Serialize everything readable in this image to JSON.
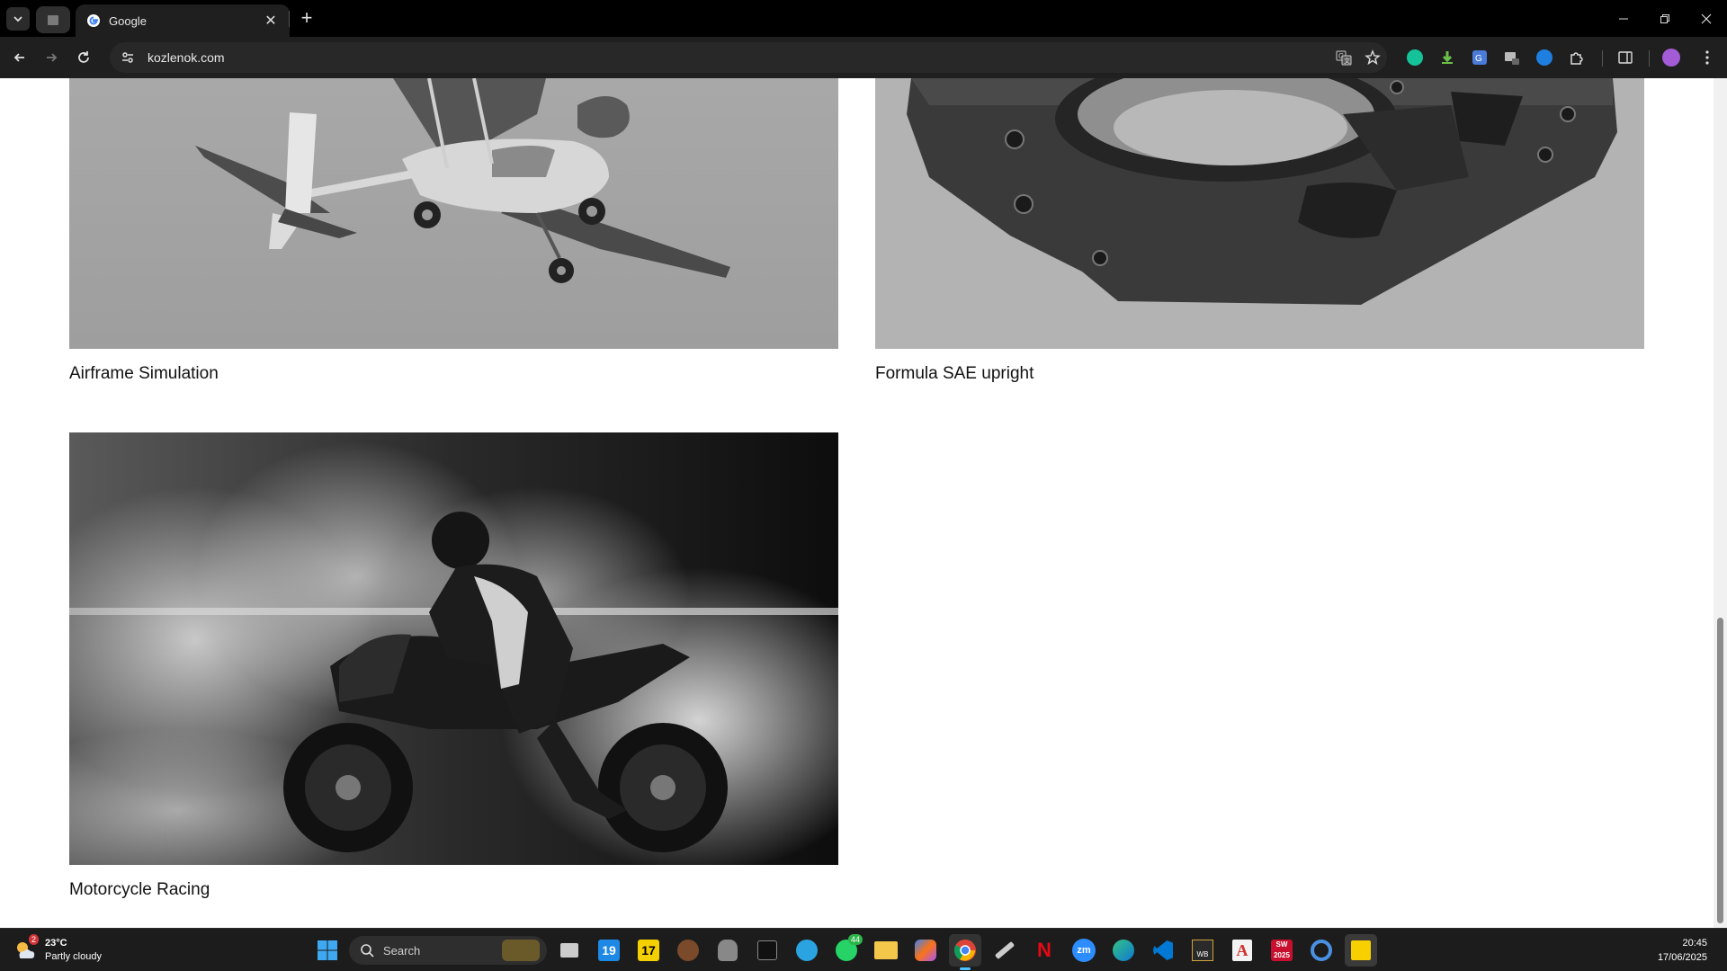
{
  "browser": {
    "tab_title": "Google",
    "url": "kozlenok.com"
  },
  "page": {
    "cards": [
      {
        "caption": "Airframe Simulation"
      },
      {
        "caption": "Formula SAE upright"
      },
      {
        "caption": "Motorcycle Racing"
      }
    ]
  },
  "taskbar": {
    "weather": {
      "temp": "23°C",
      "condition": "Partly cloudy",
      "badge": "2"
    },
    "search_placeholder": "Search",
    "whatsapp_badge": "44",
    "clock": {
      "time": "20:45",
      "date": "17/06/2025"
    }
  },
  "colors": {
    "accent": "#4a90e2",
    "chrome_bg": "#1f1f1f",
    "page_bg": "#ffffff"
  }
}
